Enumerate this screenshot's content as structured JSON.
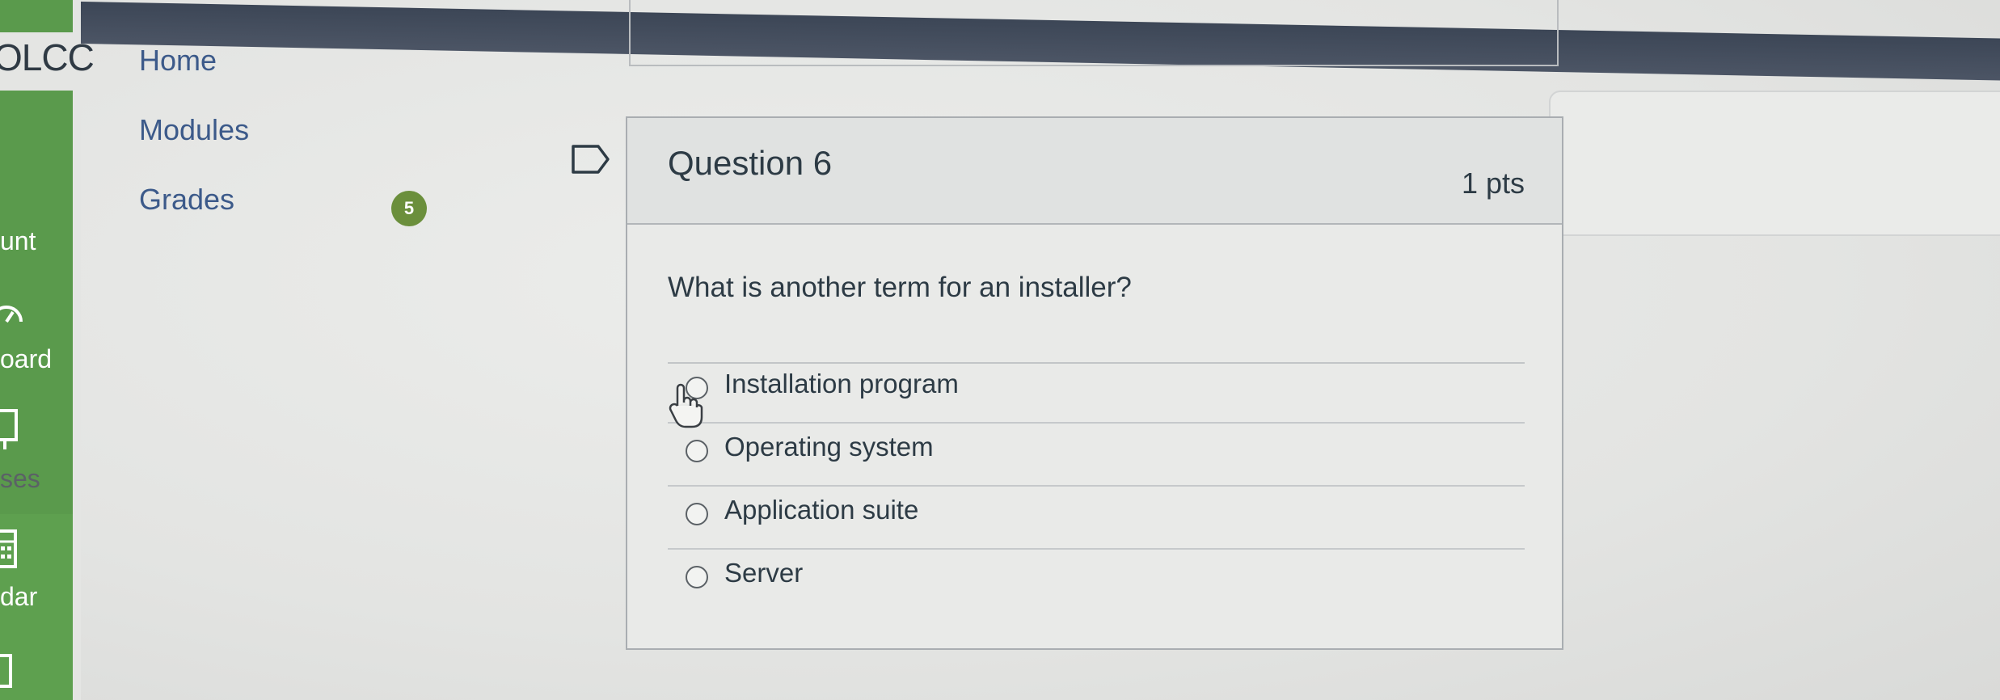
{
  "global_nav": {
    "logo_text": "OLCC",
    "items": [
      {
        "label": "unt",
        "icon": "account-avatar-icon"
      },
      {
        "label": "oard",
        "icon": "dashboard-icon"
      },
      {
        "label": "ses",
        "icon": "courses-icon"
      },
      {
        "label": "dar",
        "icon": "calendar-icon"
      }
    ]
  },
  "course_nav": {
    "items": [
      {
        "label": "Home"
      },
      {
        "label": "Modules"
      },
      {
        "label": "Grades",
        "badge": "5"
      }
    ]
  },
  "question": {
    "title": "Question 6",
    "points": "1 pts",
    "text": "What is another term for an installer?",
    "answers": [
      {
        "label": "Installation program"
      },
      {
        "label": "Operating system"
      },
      {
        "label": "Application suite"
      },
      {
        "label": "Server"
      }
    ]
  },
  "colors": {
    "nav_green": "#5a9a4c",
    "link_blue": "#3c5a8a",
    "badge_green": "#6b8f3c"
  }
}
